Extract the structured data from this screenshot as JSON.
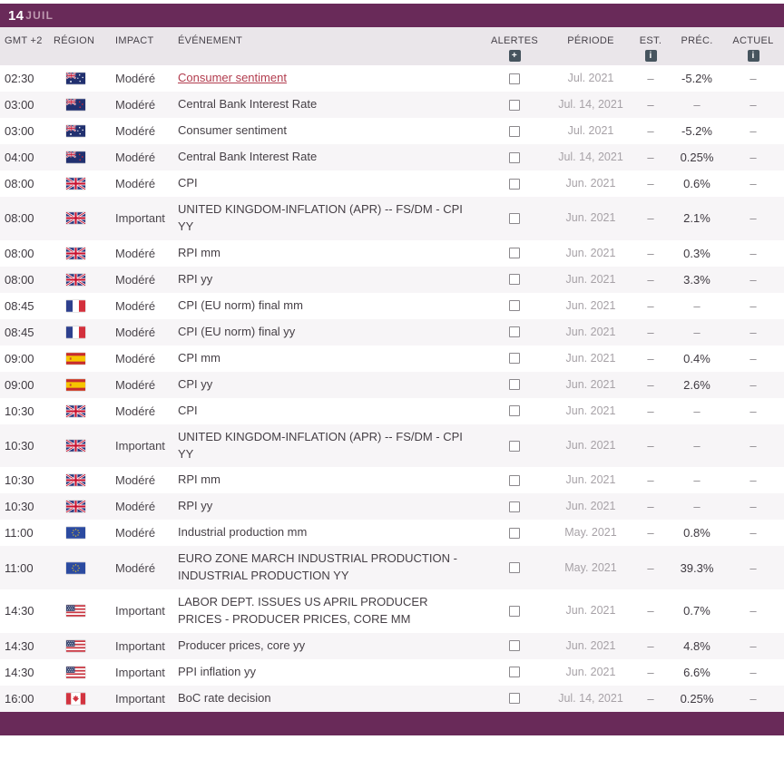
{
  "day_header": {
    "day": "14",
    "month": "JUIL"
  },
  "columns": {
    "time": "GMT +2",
    "region": "RÉGION",
    "impact": "IMPACT",
    "event": "ÉVÉNEMENT",
    "alerts": "ALERTES",
    "period": "PÉRIODE",
    "est": "EST.",
    "prev": "PRÉC.",
    "actual": "ACTUEL"
  },
  "header_icons": {
    "alerts": "plus-box-icon",
    "est": "info-icon",
    "actual": "info-icon",
    "alerts_glyph": "+",
    "info_glyph": "i"
  },
  "colors": {
    "header_bg": "#692a59",
    "month_text": "#bf9ab1",
    "colhead_bg": "#eae6ea",
    "row_alt_bg": "#f7f5f7",
    "link_color": "#b23c4e",
    "muted": "#a7a2a7"
  },
  "rows": [
    {
      "time": "02:30",
      "flag": "au",
      "impact": "Modéré",
      "event": "Consumer sentiment",
      "highlight": true,
      "period": "Jul. 2021",
      "est": "–",
      "prec": "-5.2%",
      "actual": "–"
    },
    {
      "time": "03:00",
      "flag": "nz",
      "impact": "Modéré",
      "event": "Central Bank Interest Rate",
      "period": "Jul. 14, 2021",
      "est": "–",
      "prec": "–",
      "actual": "–"
    },
    {
      "time": "03:00",
      "flag": "au",
      "impact": "Modéré",
      "event": "Consumer sentiment",
      "period": "Jul. 2021",
      "est": "–",
      "prec": "-5.2%",
      "actual": "–"
    },
    {
      "time": "04:00",
      "flag": "nz",
      "impact": "Modéré",
      "event": "Central Bank Interest Rate",
      "period": "Jul. 14, 2021",
      "est": "–",
      "prec": "0.25%",
      "actual": "–"
    },
    {
      "time": "08:00",
      "flag": "gb",
      "impact": "Modéré",
      "event": "CPI",
      "period": "Jun. 2021",
      "est": "–",
      "prec": "0.6%",
      "actual": "–"
    },
    {
      "time": "08:00",
      "flag": "gb",
      "impact": "Important",
      "event": "UNITED KINGDOM-INFLATION (APR) -- FS/DM - CPI YY",
      "period": "Jun. 2021",
      "est": "–",
      "prec": "2.1%",
      "actual": "–"
    },
    {
      "time": "08:00",
      "flag": "gb",
      "impact": "Modéré",
      "event": "RPI mm",
      "period": "Jun. 2021",
      "est": "–",
      "prec": "0.3%",
      "actual": "–"
    },
    {
      "time": "08:00",
      "flag": "gb",
      "impact": "Modéré",
      "event": "RPI yy",
      "period": "Jun. 2021",
      "est": "–",
      "prec": "3.3%",
      "actual": "–"
    },
    {
      "time": "08:45",
      "flag": "fr",
      "impact": "Modéré",
      "event": "CPI (EU norm) final mm",
      "period": "Jun. 2021",
      "est": "–",
      "prec": "–",
      "actual": "–"
    },
    {
      "time": "08:45",
      "flag": "fr",
      "impact": "Modéré",
      "event": "CPI (EU norm) final yy",
      "period": "Jun. 2021",
      "est": "–",
      "prec": "–",
      "actual": "–"
    },
    {
      "time": "09:00",
      "flag": "es",
      "impact": "Modéré",
      "event": "CPI mm",
      "period": "Jun. 2021",
      "est": "–",
      "prec": "0.4%",
      "actual": "–"
    },
    {
      "time": "09:00",
      "flag": "es",
      "impact": "Modéré",
      "event": "CPI yy",
      "period": "Jun. 2021",
      "est": "–",
      "prec": "2.6%",
      "actual": "–"
    },
    {
      "time": "10:30",
      "flag": "gb",
      "impact": "Modéré",
      "event": "CPI",
      "period": "Jun. 2021",
      "est": "–",
      "prec": "–",
      "actual": "–"
    },
    {
      "time": "10:30",
      "flag": "gb",
      "impact": "Important",
      "event": "UNITED KINGDOM-INFLATION (APR) -- FS/DM - CPI YY",
      "period": "Jun. 2021",
      "est": "–",
      "prec": "–",
      "actual": "–"
    },
    {
      "time": "10:30",
      "flag": "gb",
      "impact": "Modéré",
      "event": "RPI mm",
      "period": "Jun. 2021",
      "est": "–",
      "prec": "–",
      "actual": "–"
    },
    {
      "time": "10:30",
      "flag": "gb",
      "impact": "Modéré",
      "event": "RPI yy",
      "period": "Jun. 2021",
      "est": "–",
      "prec": "–",
      "actual": "–"
    },
    {
      "time": "11:00",
      "flag": "eu",
      "impact": "Modéré",
      "event": "Industrial production mm",
      "period": "May. 2021",
      "est": "–",
      "prec": "0.8%",
      "actual": "–"
    },
    {
      "time": "11:00",
      "flag": "eu",
      "impact": "Modéré",
      "event": "EURO ZONE MARCH INDUSTRIAL PRODUCTION - INDUSTRIAL PRODUCTION YY",
      "period": "May. 2021",
      "est": "–",
      "prec": "39.3%",
      "actual": "–"
    },
    {
      "time": "14:30",
      "flag": "us",
      "impact": "Important",
      "event": "LABOR DEPT. ISSUES US APRIL PRODUCER PRICES - PRODUCER PRICES, CORE MM",
      "period": "Jun. 2021",
      "est": "–",
      "prec": "0.7%",
      "actual": "–"
    },
    {
      "time": "14:30",
      "flag": "us",
      "impact": "Important",
      "event": "Producer prices, core yy",
      "period": "Jun. 2021",
      "est": "–",
      "prec": "4.8%",
      "actual": "–"
    },
    {
      "time": "14:30",
      "flag": "us",
      "impact": "Important",
      "event": "PPI inflation yy",
      "period": "Jun. 2021",
      "est": "–",
      "prec": "6.6%",
      "actual": "–"
    },
    {
      "time": "16:00",
      "flag": "ca",
      "impact": "Important",
      "event": "BoC rate decision",
      "period": "Jul. 14, 2021",
      "est": "–",
      "prec": "0.25%",
      "actual": "–"
    }
  ]
}
